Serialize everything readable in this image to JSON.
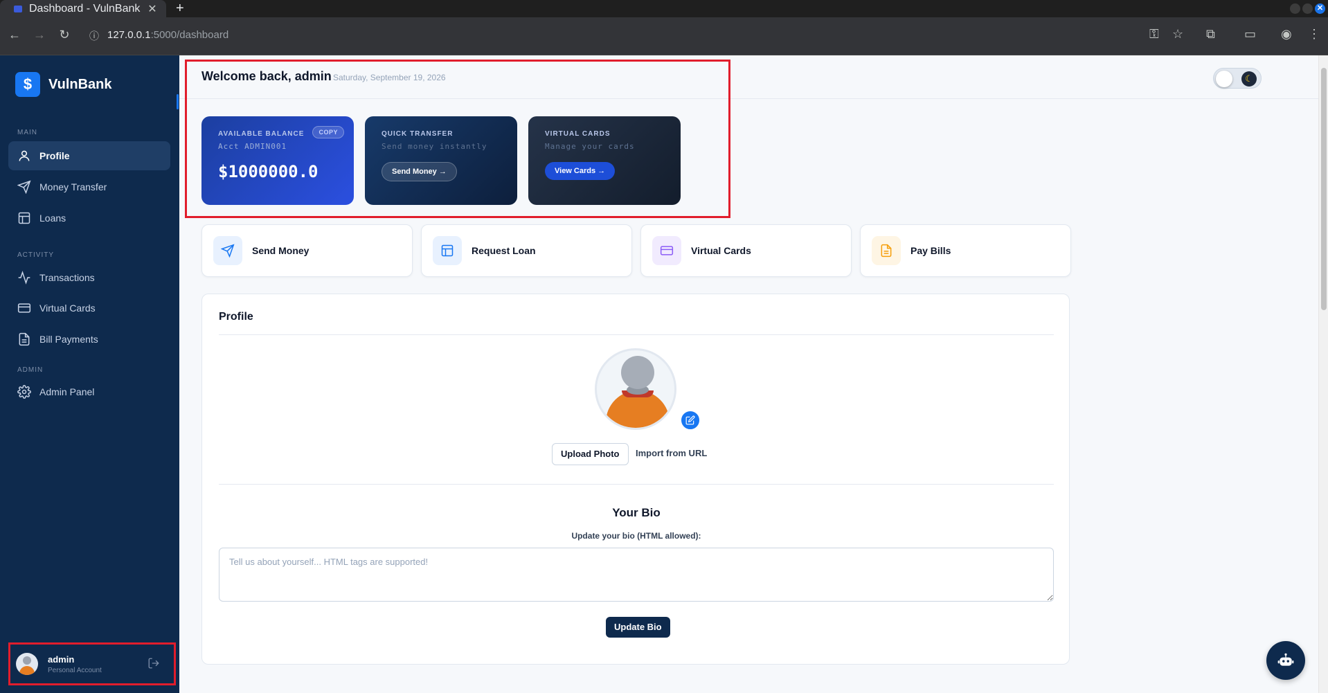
{
  "browser": {
    "tab_title": "Dashboard - VulnBank",
    "url_host": "127.0.0.1",
    "url_tail": ":5000/dashboard"
  },
  "sidebar": {
    "brand": "VulnBank",
    "brand_symbol": "$",
    "sections": {
      "main": "MAIN",
      "activity": "ACTIVITY",
      "admin": "ADMIN"
    },
    "items": [
      {
        "label": "Profile",
        "icon": "user-icon",
        "active": true
      },
      {
        "label": "Money Transfer",
        "icon": "send-icon",
        "active": false
      },
      {
        "label": "Loans",
        "icon": "layout-icon",
        "active": false
      },
      {
        "label": "Transactions",
        "icon": "activity-icon",
        "active": false
      },
      {
        "label": "Virtual Cards",
        "icon": "credit-card-icon",
        "active": false
      },
      {
        "label": "Bill Payments",
        "icon": "file-icon",
        "active": false
      },
      {
        "label": "Admin Panel",
        "icon": "gear-icon",
        "active": false
      }
    ],
    "user": {
      "name": "admin",
      "type": "Personal Account"
    }
  },
  "header": {
    "welcome": "Welcome back, admin",
    "date": "Saturday, September 19, 2026"
  },
  "cards": {
    "balance": {
      "label": "AVAILABLE BALANCE",
      "account": "Acct ADMIN001",
      "amount": "$1000000.0",
      "copy": "COPY"
    },
    "transfer": {
      "label": "QUICK TRANSFER",
      "sub": "Send money instantly",
      "button": "Send Money →"
    },
    "virtual": {
      "label": "VIRTUAL CARDS",
      "sub": "Manage your cards",
      "button": "View Cards →"
    }
  },
  "quick_actions": [
    {
      "label": "Send Money",
      "icon": "send-icon",
      "color": "#1877f2",
      "bg": "#e8f1fe"
    },
    {
      "label": "Request Loan",
      "icon": "layout-icon",
      "color": "#1877f2",
      "bg": "#e8f1fe"
    },
    {
      "label": "Virtual Cards",
      "icon": "credit-card-icon",
      "color": "#8b5cf6",
      "bg": "#f1ebfe"
    },
    {
      "label": "Pay Bills",
      "icon": "file-icon",
      "color": "#f59e0b",
      "bg": "#fef5e4"
    }
  ],
  "profile": {
    "title": "Profile",
    "upload": "Upload Photo",
    "import": "Import from URL",
    "bio_title": "Your Bio",
    "bio_label": "Update your bio (HTML allowed):",
    "bio_placeholder": "Tell us about yourself... HTML tags are supported!",
    "bio_button": "Update Bio"
  },
  "colors": {
    "sidebar_bg": "#0e2a4d",
    "accent": "#1877f2",
    "highlight_border": "#e11d2c"
  }
}
